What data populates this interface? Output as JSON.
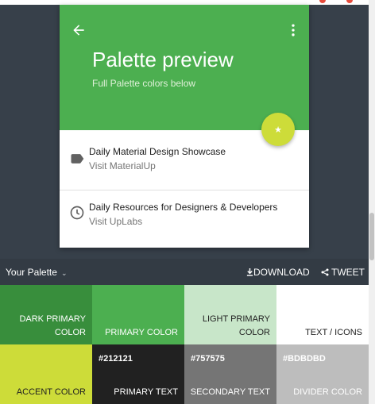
{
  "app": {
    "title": "Palette preview",
    "subtitle": "Full Palette colors below"
  },
  "list": [
    {
      "title": "Daily Material Design Showcase",
      "subtitle": "Visit MaterialUp",
      "icon": "label-icon"
    },
    {
      "title": "Daily Resources for Designers & Developers",
      "subtitle": "Visit UpLabs",
      "icon": "clock-icon"
    }
  ],
  "fab": {
    "glyph": "★",
    "icon": "star-icon"
  },
  "palette_bar": {
    "label": "Your Palette",
    "download_label": "DOWNLOAD",
    "tweet_label": "TWEET"
  },
  "colors": {
    "dark_primary": "#388e3c",
    "primary": "#4caf50",
    "light_primary": "#c8e6c9",
    "text_icons": "#ffffff",
    "accent": "#cddc39",
    "primary_text": "#212121",
    "secondary_text": "#757575",
    "divider": "#bdbdbd"
  },
  "swatches": {
    "row1": [
      {
        "label_l1": "DARK PRIMARY",
        "label_l2": "COLOR"
      },
      {
        "label_l1": "PRIMARY COLOR"
      },
      {
        "label_l1": "LIGHT PRIMARY",
        "label_l2": "COLOR"
      },
      {
        "label_l1": "TEXT / ICONS"
      }
    ],
    "row2": [
      {
        "label_l1": "ACCENT COLOR"
      },
      {
        "hex": "#212121",
        "label_l1": "PRIMARY TEXT"
      },
      {
        "hex": "#757575",
        "label_l1": "SECONDARY TEXT"
      },
      {
        "hex": "#BDBDBD",
        "label_l1": "DIVIDER COLOR"
      }
    ]
  }
}
